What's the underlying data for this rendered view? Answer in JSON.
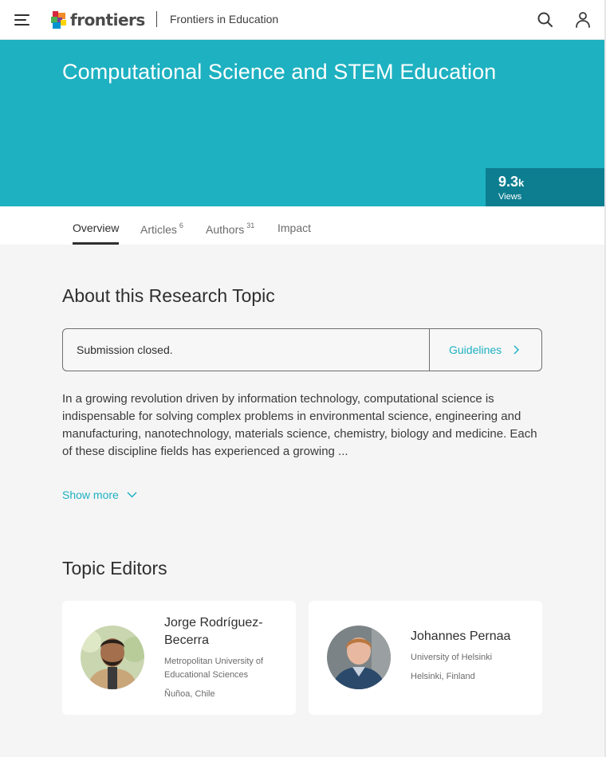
{
  "header": {
    "brand": "frontiers",
    "journal": "Frontiers in Education",
    "icons": {
      "menu": "hamburger-menu-icon",
      "search": "search-icon",
      "account": "user-icon"
    }
  },
  "hero": {
    "title": "Computational Science and STEM Education",
    "views_value": "9.3",
    "views_suffix": "k",
    "views_label": "Views",
    "colors": {
      "background": "#1eb1c1",
      "views_box": "#0c7e90"
    }
  },
  "tabs": [
    {
      "label": "Overview",
      "count": "",
      "active": true
    },
    {
      "label": "Articles",
      "count": "6",
      "active": false
    },
    {
      "label": "Authors",
      "count": "31",
      "active": false
    },
    {
      "label": "Impact",
      "count": "",
      "active": false
    }
  ],
  "about": {
    "title": "About this Research Topic",
    "submission_status": "Submission closed.",
    "guidelines_label": "Guidelines",
    "description": "In a growing revolution driven by information technology, computational science is indispensable for solving complex problems in environmental science, engineering and manufacturing, nanotechnology, materials science, chemistry, biology and medicine. Each of these discipline fields has experienced a growing ...",
    "show_more_label": "Show more"
  },
  "editors": {
    "title": "Topic Editors",
    "items": [
      {
        "name": "Jorge Rodríguez-Becerra",
        "institution": "Metropolitan University of Educational Sciences",
        "location": "Ñuñoa, Chile"
      },
      {
        "name": "Johannes Pernaa",
        "institution": "University of Helsinki",
        "location": "Helsinki, Finland"
      }
    ]
  },
  "accent_color": "#1eb1c1"
}
